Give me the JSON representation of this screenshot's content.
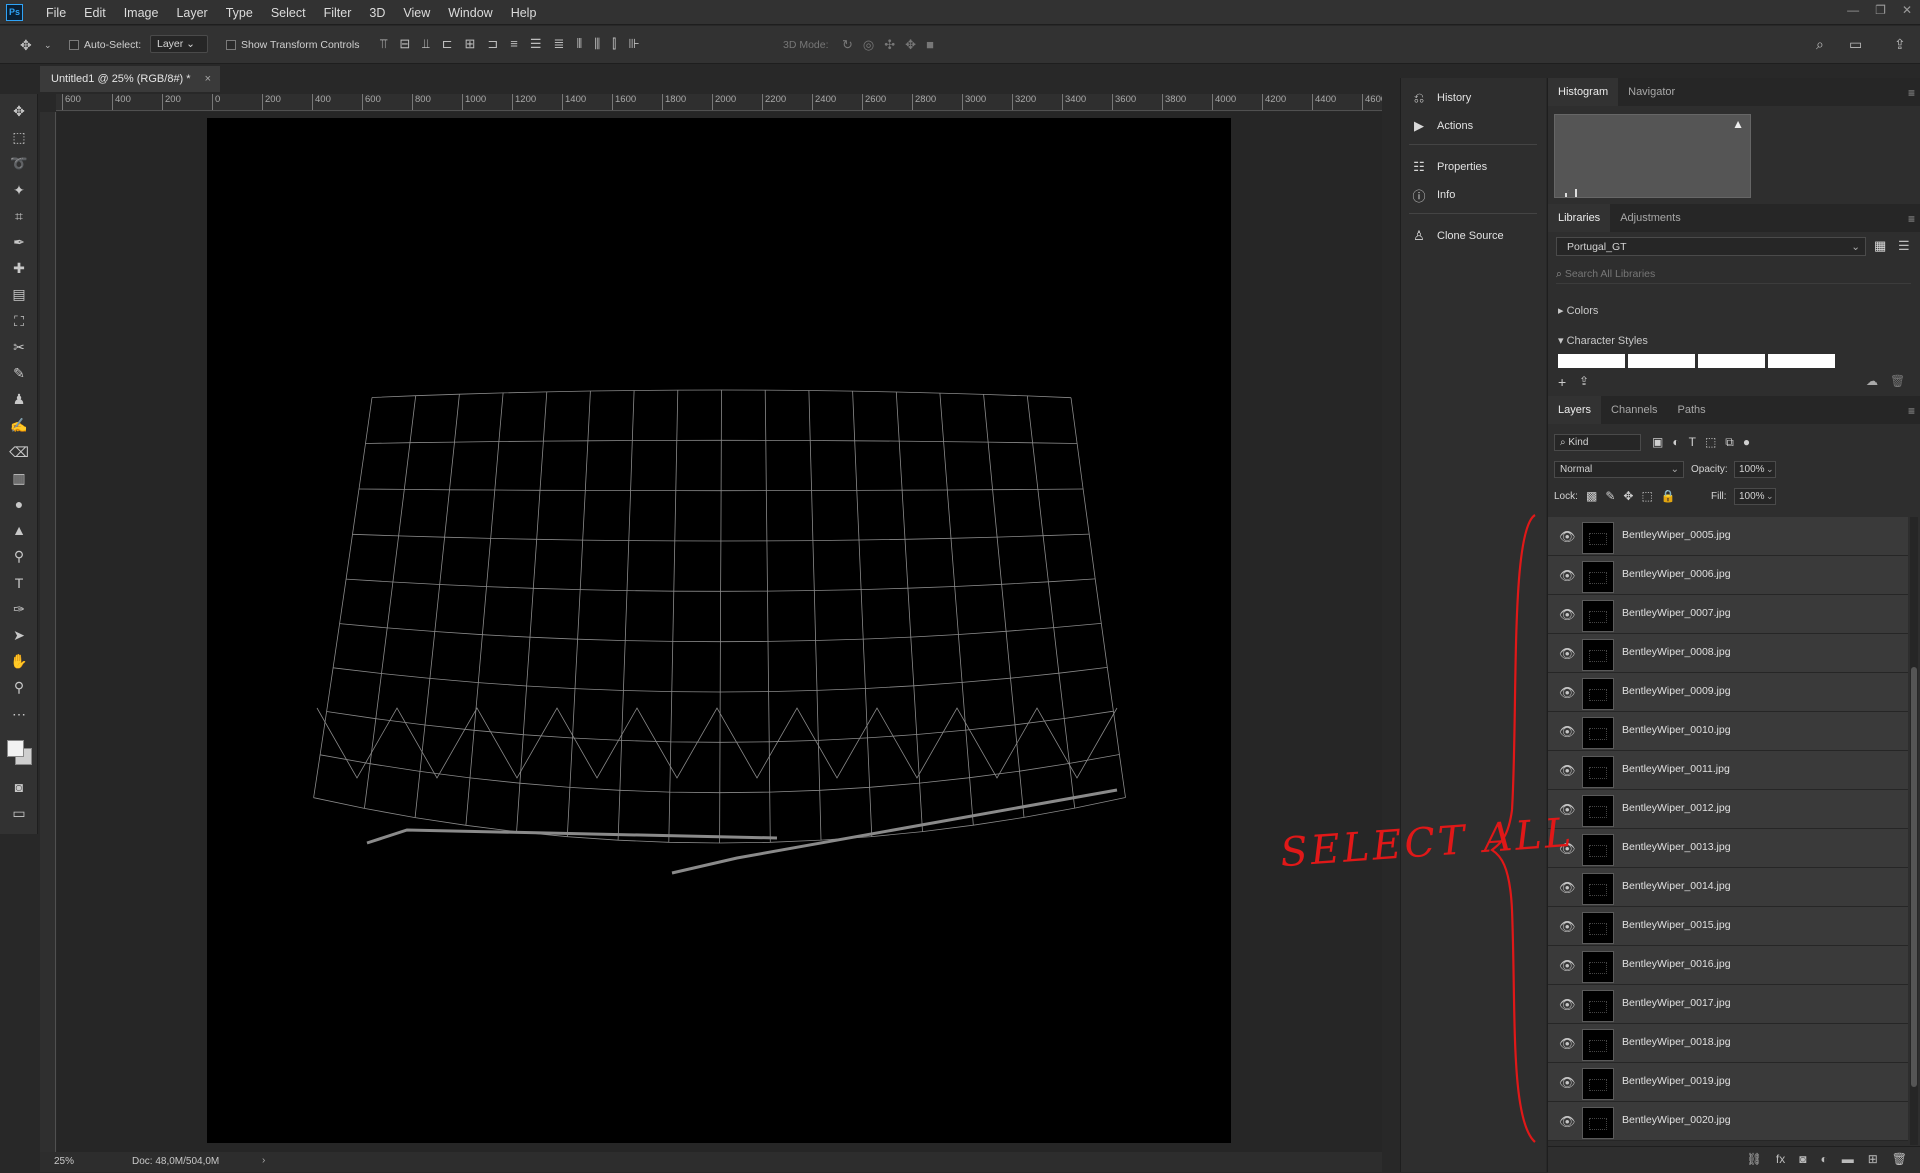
{
  "app": {
    "logo": "Ps",
    "menu": [
      "File",
      "Edit",
      "Image",
      "Layer",
      "Type",
      "Select",
      "Filter",
      "3D",
      "View",
      "Window",
      "Help"
    ]
  },
  "options": {
    "auto_select_label": "Auto-Select:",
    "auto_select_value": "Layer",
    "transform_label": "Show Transform Controls",
    "mode_label": "3D Mode:"
  },
  "document": {
    "tab_title": "Untitled1 @ 25% (RGB/8#) *",
    "zoom": "25%",
    "doc_info": "Doc: 48,0M/504,0M"
  },
  "ruler_top": [
    "600",
    "400",
    "200",
    "0",
    "200",
    "400",
    "600",
    "800",
    "1000",
    "1200",
    "1400",
    "1600",
    "1800",
    "2000",
    "2200",
    "2400",
    "2600",
    "2800",
    "3000",
    "3200",
    "3400",
    "3600",
    "3800",
    "4000",
    "4200",
    "4400",
    "4600"
  ],
  "mid_panel": [
    {
      "icon": "history-icon",
      "label": "History"
    },
    {
      "icon": "actions-icon",
      "label": "Actions"
    },
    {
      "icon": "properties-icon",
      "label": "Properties"
    },
    {
      "icon": "info-icon",
      "label": "Info"
    },
    {
      "icon": "clone-source-icon",
      "label": "Clone Source"
    }
  ],
  "histogram": {
    "tabs": [
      "Histogram",
      "Navigator"
    ]
  },
  "libraries": {
    "tabs": [
      "Libraries",
      "Adjustments"
    ],
    "library": "Portugal_GT",
    "search_placeholder": "Search All Libraries",
    "sections": [
      "Colors",
      "Character Styles"
    ]
  },
  "layers": {
    "tabs": [
      "Layers",
      "Channels",
      "Paths"
    ],
    "kind": "Kind",
    "blend": "Normal",
    "opacity_label": "Opacity:",
    "opacity": "100%",
    "lock_label": "Lock:",
    "fill_label": "Fill:",
    "fill": "100%",
    "items": [
      "BentleyWiper_0005.jpg",
      "BentleyWiper_0006.jpg",
      "BentleyWiper_0007.jpg",
      "BentleyWiper_0008.jpg",
      "BentleyWiper_0009.jpg",
      "BentleyWiper_0010.jpg",
      "BentleyWiper_0011.jpg",
      "BentleyWiper_0012.jpg",
      "BentleyWiper_0013.jpg",
      "BentleyWiper_0014.jpg",
      "BentleyWiper_0015.jpg",
      "BentleyWiper_0016.jpg",
      "BentleyWiper_0017.jpg",
      "BentleyWiper_0018.jpg",
      "BentleyWiper_0019.jpg",
      "BentleyWiper_0020.jpg"
    ]
  },
  "annotation": {
    "text": "SELECT ALL",
    "color": "#e01818"
  }
}
